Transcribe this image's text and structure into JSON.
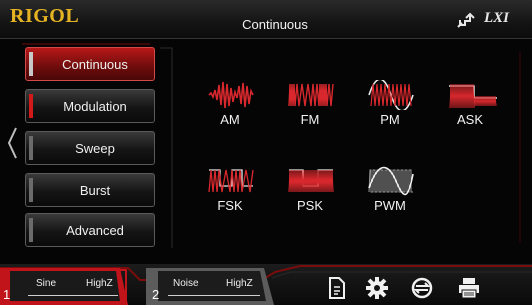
{
  "header": {
    "brand": "RIGOL",
    "title": "Continuous",
    "lan_icon": "lan-connection-icon",
    "lxi_label": "LXI"
  },
  "menu": {
    "items": [
      {
        "label": "Continuous",
        "state": "selected"
      },
      {
        "label": "Modulation",
        "state": "highlighted"
      },
      {
        "label": "Sweep",
        "state": "normal"
      },
      {
        "label": "Burst",
        "state": "normal"
      },
      {
        "label": "Advanced",
        "state": "normal"
      }
    ]
  },
  "modulation_types": [
    {
      "label": "AM",
      "icon": "am-waveform-icon"
    },
    {
      "label": "FM",
      "icon": "fm-waveform-icon"
    },
    {
      "label": "PM",
      "icon": "pm-waveform-icon"
    },
    {
      "label": "ASK",
      "icon": "ask-waveform-icon"
    },
    {
      "label": "FSK",
      "icon": "fsk-waveform-icon"
    },
    {
      "label": "PSK",
      "icon": "psk-waveform-icon"
    },
    {
      "label": "PWM",
      "icon": "pwm-waveform-icon"
    }
  ],
  "channels": [
    {
      "number": "1",
      "waveform": "Sine",
      "load": "HighZ",
      "color": "#d21a1a"
    },
    {
      "number": "2",
      "waveform": "Noise",
      "load": "HighZ",
      "color": "#6b6b6b"
    }
  ],
  "toolbar_icons": [
    "file-icon",
    "gear-icon",
    "sync-icon",
    "printer-icon"
  ],
  "colors": {
    "accent": "#c0141a",
    "brand": "#e6b422",
    "background": "#050505"
  }
}
